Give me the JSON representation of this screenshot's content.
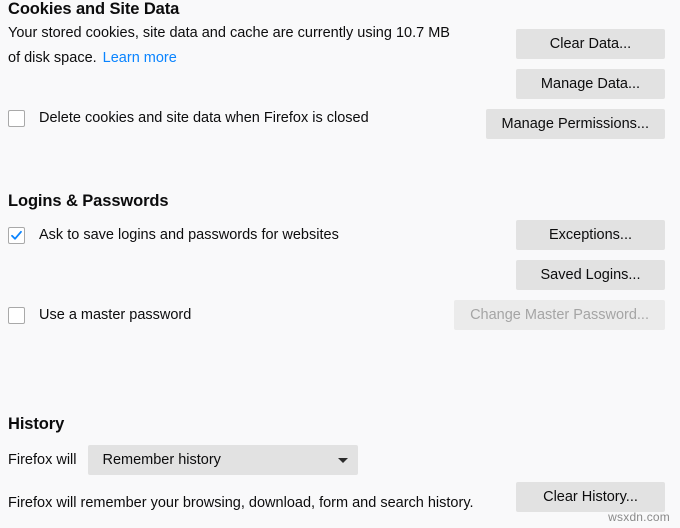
{
  "cookies_section": {
    "title": "Cookies and Site Data",
    "description_line1": "Your stored cookies, site data and cache are currently using 10.7 MB",
    "description_line2": "of disk space.",
    "learn_more_label": "Learn more",
    "delete_on_close": {
      "label": "Delete cookies and site data when Firefox is closed",
      "checked": "false"
    },
    "buttons": {
      "clear_data": "Clear Data...",
      "manage_data": "Manage Data...",
      "manage_permissions": "Manage Permissions..."
    }
  },
  "logins_section": {
    "title": "Logins & Passwords",
    "ask_to_save": {
      "label": "Ask to save logins and passwords for websites",
      "checked": "true"
    },
    "use_master_password": {
      "label": "Use a master password",
      "checked": "false"
    },
    "buttons": {
      "exceptions": "Exceptions...",
      "saved_logins": "Saved Logins...",
      "change_master_password": "Change Master Password..."
    }
  },
  "history_section": {
    "title": "History",
    "prelabel": "Firefox will",
    "mode_selected": "Remember history",
    "note": "Firefox will remember your browsing, download, form and search history.",
    "buttons": {
      "clear_history": "Clear History..."
    }
  },
  "watermark": "wsxdn.com",
  "colors": {
    "background": "#f9f9fa",
    "link": "#0a84ff",
    "checkmark": "#0a84ff",
    "button_bg": "#e2e2e2",
    "button_disabled_bg": "#ebebeb",
    "button_disabled_text": "#a5a5a5",
    "text": "#0c0c0d"
  }
}
